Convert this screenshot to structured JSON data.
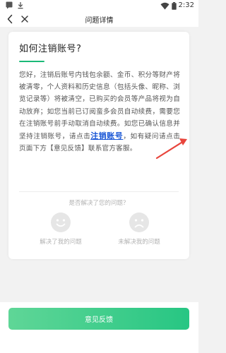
{
  "status_bar": {
    "time": "2:32",
    "icons": [
      "message-square-icon",
      "download-icon",
      "wifi-icon",
      "battery-icon"
    ]
  },
  "nav": {
    "title": "问题详情",
    "back_icon": "back-chevron-icon",
    "close_icon": "close-icon"
  },
  "article": {
    "question": "如何注销账号?",
    "answer_part1": "您好，注销后账号内钱包余额、金币、积分等财产将被清零，个人资料和历史信息（包括头像、昵称、浏览记录等）将被清空，已购买的会员等产品将视为自动放弃；如您当前已订阅蛮多会员自动续费，需要您在注销账号前手动取消自动续费。如您已确认信息并坚持注销账号，请点击",
    "answer_link": "注销账号",
    "answer_part2": "，如有疑问请点击页面下方【意见反馈】联系官方客服。"
  },
  "feedback": {
    "question": "是否解决了您的问题？",
    "solved_label": "解决了我的问题",
    "unsolved_label": "未解决我的问题"
  },
  "bottom_button": {
    "label": "意见反馈"
  },
  "colors": {
    "accent": "#27c683",
    "link": "#1a57d6",
    "arrow": "#e8453c",
    "background": "#f2f2f2"
  }
}
